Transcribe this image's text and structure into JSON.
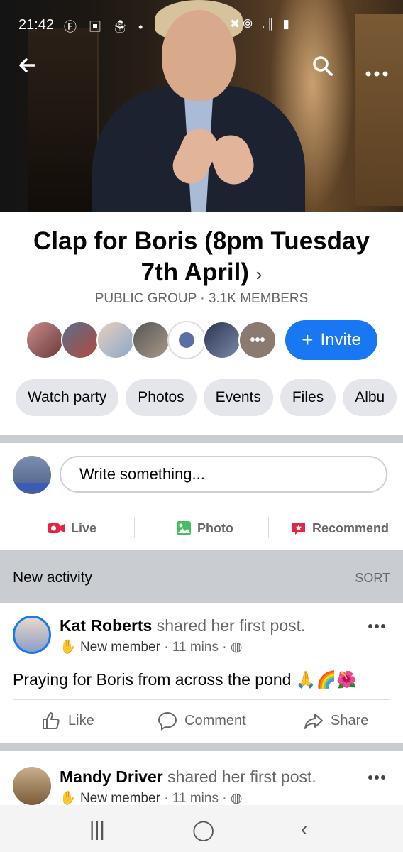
{
  "status_bar": {
    "time": "21:42",
    "left_icons": "Ⓕ ▣ ☃ •",
    "right_icons": "✖⦾ .∥ ▮"
  },
  "header": {
    "back_icon": "arrow-left-icon",
    "search_icon": "search-icon",
    "more_icon": "more-horizontal-icon"
  },
  "group": {
    "title": "Clap for Boris (8pm Tuesday 7th April)",
    "title_chevron": "›",
    "meta": "PUBLIC GROUP · 3.1K MEMBERS",
    "members_more": "•••",
    "invite_label": "Invite",
    "invite_plus": "+"
  },
  "tabs": [
    "Watch party",
    "Photos",
    "Events",
    "Files",
    "Albu"
  ],
  "composer": {
    "placeholder": "Write something...",
    "actions": {
      "live": "Live",
      "photo": "Photo",
      "recommend": "Recommend"
    }
  },
  "activity": {
    "title": "New activity",
    "sort": "SORT"
  },
  "posts": [
    {
      "author": "Kat Roberts",
      "action": " shared her first post.",
      "badge": "New member",
      "time": "11 mins",
      "text": "Praying for Boris from across the pond",
      "emoji": "🙏🌈🌺",
      "like": "Like",
      "comment": "Comment",
      "share": "Share"
    },
    {
      "author": "Mandy Driver",
      "action": " shared her first post.",
      "badge": "New member",
      "time": "11 mins"
    }
  ],
  "android_nav": {
    "recents": "|||",
    "home": "◯",
    "back": "‹"
  },
  "colors": {
    "accent": "#1877f2",
    "live": "#e42645",
    "photo": "#45bd62",
    "recommend": "#e42645"
  }
}
